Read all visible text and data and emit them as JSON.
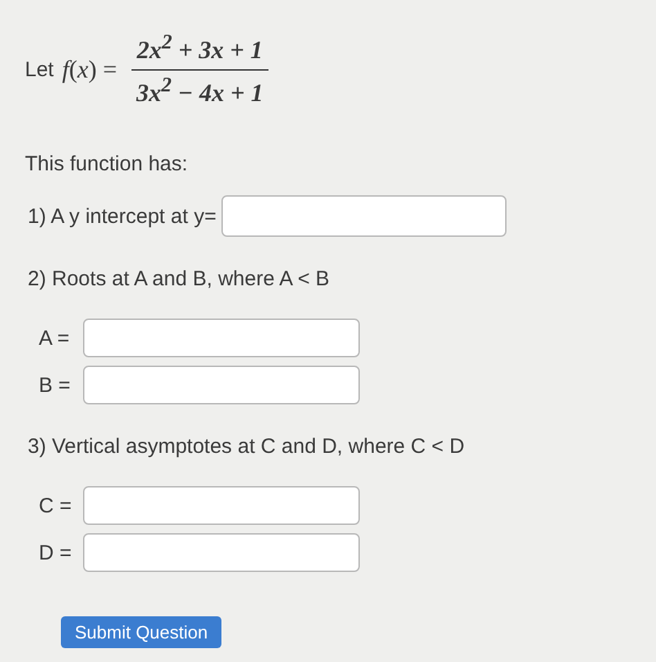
{
  "intro": {
    "label": "Let",
    "function": "*f*(*x*) =",
    "numerator": "2x$^{2}$ + 3x + 1",
    "denominator": "3x$^{2}$ − 4x + 1"
  },
  "lead": "This function has:",
  "parts": [
    {
      "kind": "inline",
      "prompt": "1) A y intercept at y="
    },
    {
      "kind": "list",
      "prompt": "2) Roots at A and B, where A < B",
      "fields": [
        {
          "label": "A ="
        },
        {
          "label": "B ="
        }
      ]
    },
    {
      "kind": "list",
      "prompt": "3) Vertical asymptotes at C and D, where C < D",
      "fields": [
        {
          "label": "C ="
        },
        {
          "label": "D ="
        }
      ]
    }
  ],
  "submit": "Submit Question"
}
